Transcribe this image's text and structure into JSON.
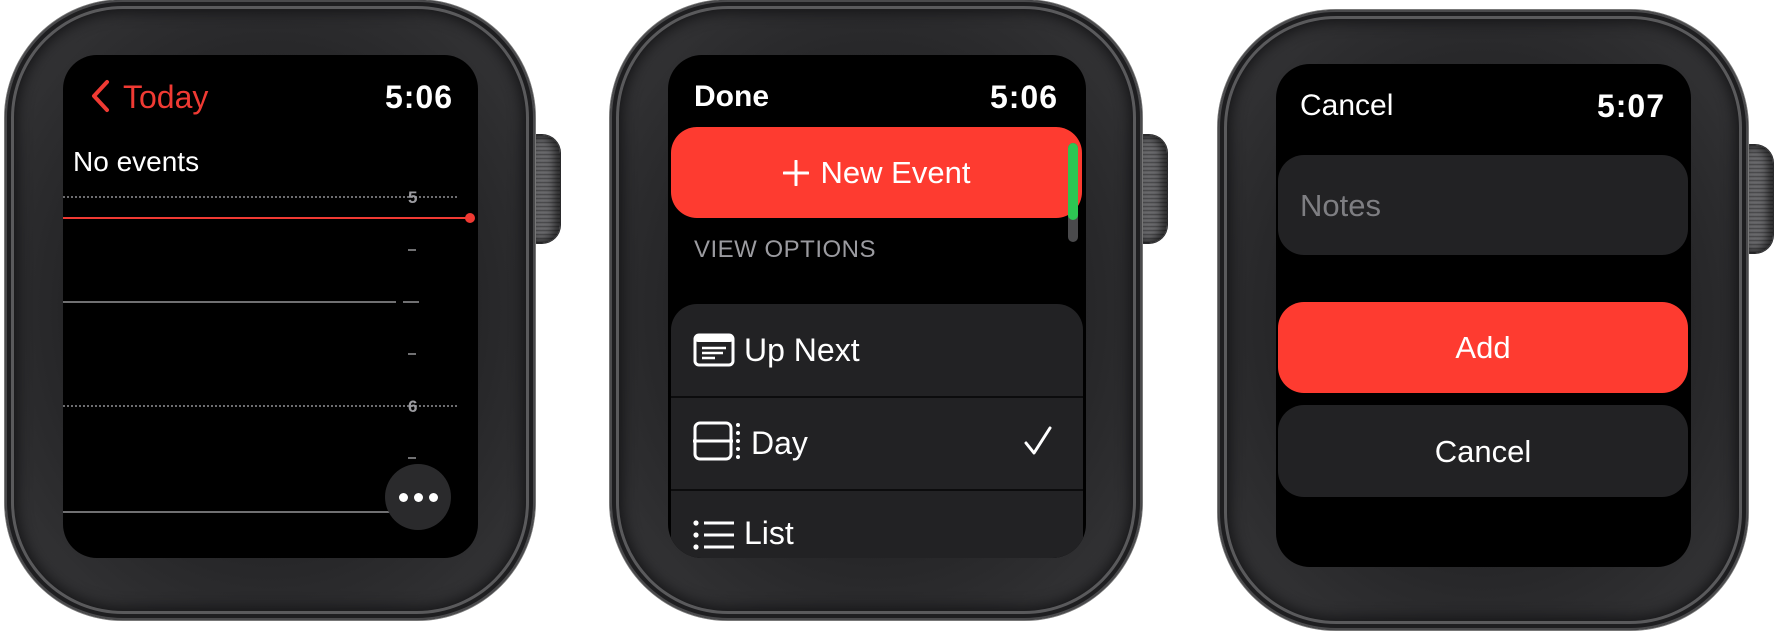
{
  "colors": {
    "accent_red": "#fe3b30",
    "text_red": "#f03a33",
    "scroll_green": "#2dc653",
    "cell_bg": "#222224"
  },
  "watch1": {
    "back_label": "Today",
    "back_icon": "chevron-left-icon",
    "time": "5:06",
    "empty_message": "No events",
    "hour_labels": [
      "5",
      "6"
    ],
    "current_time_indicator": "current-time-line",
    "more_button_icon": "ellipsis-icon"
  },
  "watch2": {
    "done_label": "Done",
    "time": "5:06",
    "new_event_icon": "plus-icon",
    "new_event_label": "New Event",
    "section_header": "VIEW OPTIONS",
    "options": [
      {
        "label": "Up Next",
        "icon": "up-next-icon",
        "selected": false
      },
      {
        "label": "Day",
        "icon": "day-view-icon",
        "selected": true
      },
      {
        "label": "List",
        "icon": "list-icon",
        "selected": false
      }
    ],
    "selected_icon": "checkmark-icon"
  },
  "watch3": {
    "cancel_label": "Cancel",
    "time": "5:07",
    "notes_placeholder": "Notes",
    "add_label": "Add",
    "cancel_button_label": "Cancel"
  }
}
